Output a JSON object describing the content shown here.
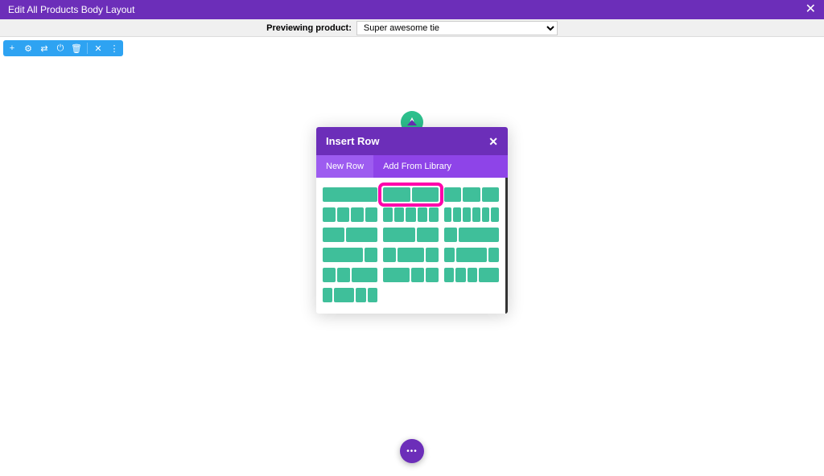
{
  "topbar": {
    "title": "Edit All Products Body Layout",
    "close_glyph": "✕"
  },
  "preview": {
    "label": "Previewing product:",
    "selected": "Super awesome tie"
  },
  "toolbar": {
    "icons": {
      "add": "+",
      "settings": "⚙",
      "duplicate": "⇄",
      "power": "⏻",
      "delete": "🗑",
      "close": "✕",
      "more": "⋮"
    }
  },
  "modal": {
    "title": "Insert Row",
    "close_glyph": "✕",
    "tabs": {
      "new_row": "New Row",
      "add_library": "Add From Library"
    }
  },
  "section_handle": {
    "glyph": "▴"
  },
  "fab": {
    "glyph": "•••"
  },
  "layouts": [
    {
      "cols": [
        1
      ]
    },
    {
      "cols": [
        1,
        1
      ],
      "highlight": true
    },
    {
      "cols": [
        1,
        1,
        1
      ]
    },
    {
      "cols": [
        1,
        1,
        1,
        1
      ]
    },
    {
      "cols": [
        1,
        1,
        1,
        1,
        1
      ]
    },
    {
      "cols": [
        1,
        1,
        1,
        1,
        1,
        1
      ]
    },
    {
      "cols": [
        2,
        3
      ]
    },
    {
      "cols": [
        3,
        2
      ]
    },
    {
      "cols": [
        1,
        3
      ]
    },
    {
      "cols": [
        3,
        1
      ]
    },
    {
      "cols": [
        1,
        2,
        1
      ]
    },
    {
      "cols": [
        1,
        3,
        1
      ]
    },
    {
      "cols": [
        1,
        1,
        2
      ]
    },
    {
      "cols": [
        2,
        1,
        1
      ]
    },
    {
      "cols": [
        1,
        1,
        1,
        2
      ]
    },
    {
      "cols": [
        1,
        2,
        1,
        1
      ]
    }
  ]
}
